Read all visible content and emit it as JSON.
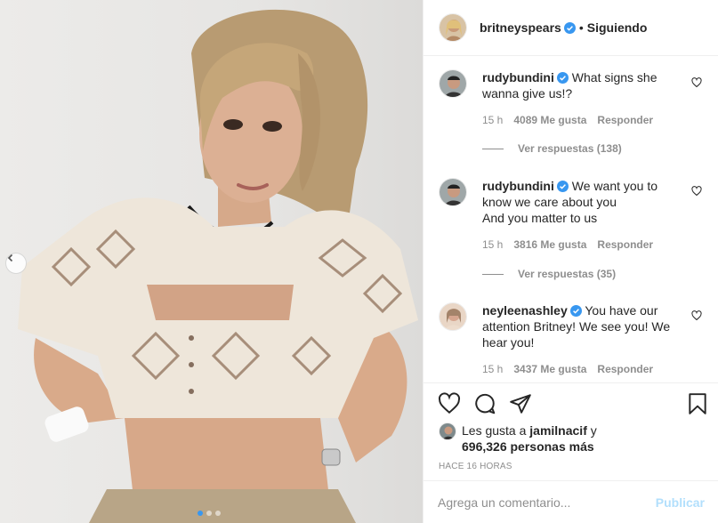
{
  "post": {
    "author": "britneyspears",
    "separator": "•",
    "follow_status": "Siguiendo",
    "carousel": {
      "count": 3,
      "active_index": 0
    }
  },
  "comments": [
    {
      "username": "rudybundini",
      "text": "What signs she wanna give us!?",
      "time": "15 h",
      "likes": "4089 Me gusta",
      "reply_label": "Responder",
      "view_replies": "Ver respuestas (138)"
    },
    {
      "username": "rudybundini",
      "text_line1": "We want you to know we care about you",
      "text_line2": "And you matter to us",
      "time": "15 h",
      "likes": "3816 Me gusta",
      "reply_label": "Responder",
      "view_replies": "Ver respuestas (35)"
    },
    {
      "username": "neyleenashley",
      "text": "You have our attention Britney! We see you! We hear you!",
      "time": "15 h",
      "likes": "3437 Me gusta",
      "reply_label": "Responder"
    }
  ],
  "likes_summary": {
    "prefix": "Les gusta a",
    "user": "jamilnacif",
    "conjunction": "y",
    "count": "696,326",
    "suffix": "personas más"
  },
  "timestamp": "HACE 16 HORAS",
  "comment_input": {
    "placeholder": "Agrega un comentario...",
    "post_label": "Publicar"
  },
  "colors": {
    "verified": "#3897f0",
    "publish_disabled": "#b2dffc",
    "muted": "#8e8e8e"
  },
  "icons": [
    "chevron-left-icon",
    "verified-badge-icon",
    "heart-icon",
    "comment-icon",
    "share-icon",
    "bookmark-icon"
  ]
}
